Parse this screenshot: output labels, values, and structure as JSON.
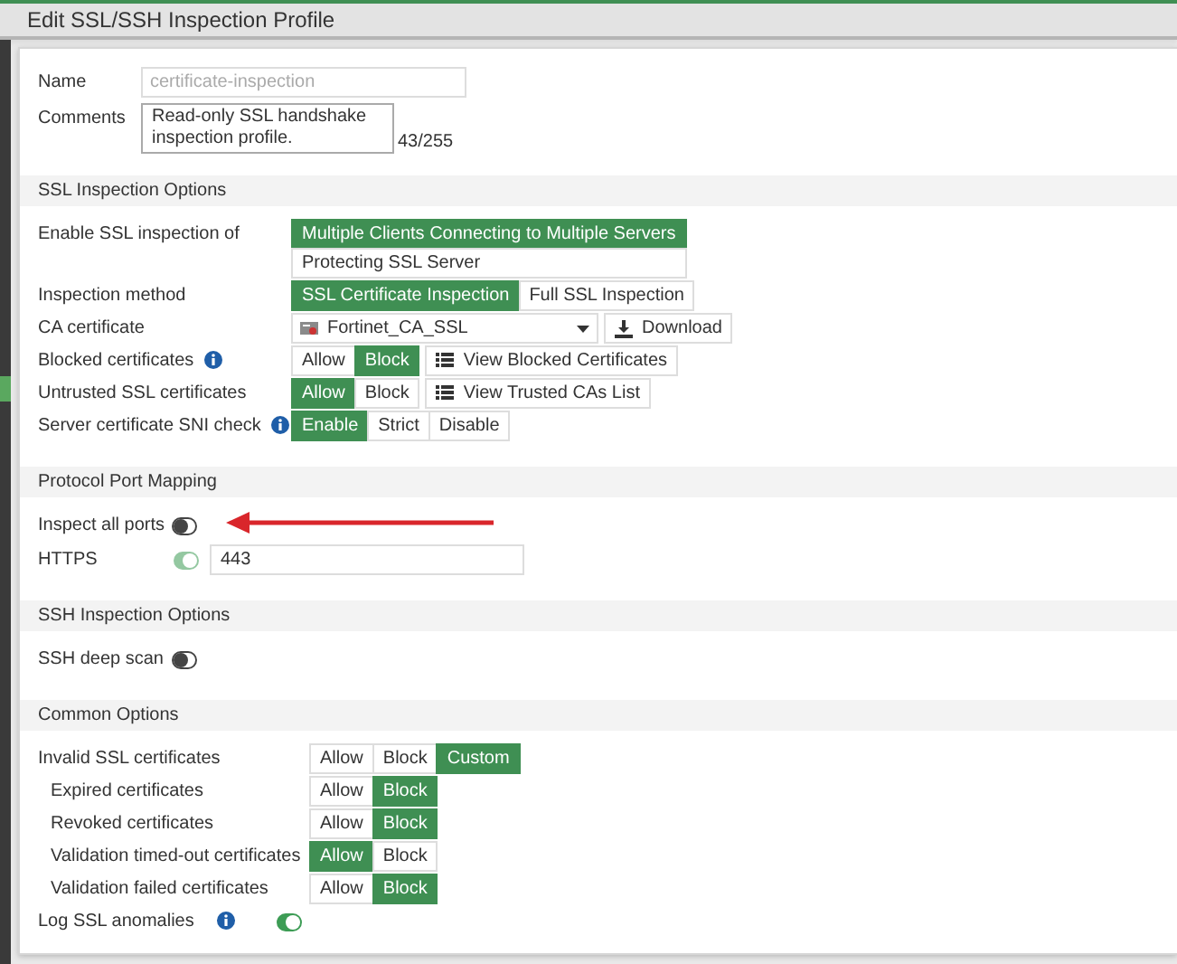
{
  "title": "Edit SSL/SSH Inspection Profile",
  "name_field": {
    "label": "Name",
    "value": "certificate-inspection",
    "disabled": true
  },
  "comments_field": {
    "label": "Comments",
    "value": "Read-only SSL handshake inspection profile.",
    "counter": "43/255"
  },
  "sections": [
    {
      "title": "SSL Inspection Options",
      "rows": [
        {
          "kind": "stacked",
          "label": "Enable SSL inspection of",
          "options": [
            {
              "label": "Multiple Clients Connecting to Multiple Servers",
              "selected": true
            },
            {
              "label": "Protecting SSL Server",
              "selected": false
            }
          ]
        },
        {
          "kind": "segmented",
          "label": "Inspection method",
          "options": [
            {
              "label": "SSL Certificate Inspection",
              "selected": true
            },
            {
              "label": "Full SSL Inspection",
              "selected": false
            }
          ]
        },
        {
          "kind": "select",
          "label": "CA certificate",
          "value": "Fortinet_CA_SSL",
          "button": "Download"
        },
        {
          "kind": "segmented",
          "label": "Blocked certificates",
          "info": true,
          "options": [
            {
              "label": "Allow",
              "selected": false
            },
            {
              "label": "Block",
              "selected": true
            }
          ],
          "button": "View Blocked Certificates"
        },
        {
          "kind": "segmented",
          "label": "Untrusted SSL certificates",
          "options": [
            {
              "label": "Allow",
              "selected": true
            },
            {
              "label": "Block",
              "selected": false
            }
          ],
          "button": "View Trusted CAs List"
        },
        {
          "kind": "segmented",
          "label": "Server certificate SNI check",
          "info": true,
          "options": [
            {
              "label": "Enable",
              "selected": true
            },
            {
              "label": "Strict",
              "selected": false
            },
            {
              "label": "Disable",
              "selected": false
            }
          ]
        }
      ]
    },
    {
      "title": "Protocol Port Mapping",
      "rows": [
        {
          "kind": "toggle",
          "label": "Inspect all ports",
          "on": false
        },
        {
          "kind": "port",
          "label": "HTTPS",
          "on": true,
          "disabled": true,
          "value": "443"
        }
      ]
    },
    {
      "title": "SSH Inspection Options",
      "rows": [
        {
          "kind": "toggle",
          "label": "SSH deep scan",
          "on": false
        }
      ]
    },
    {
      "title": "Common Options",
      "rows": [
        {
          "kind": "segmented",
          "label": "Invalid SSL certificates",
          "options": [
            {
              "label": "Allow",
              "selected": false
            },
            {
              "label": "Block",
              "selected": false
            },
            {
              "label": "Custom",
              "selected": true
            }
          ],
          "children": [
            {
              "kind": "segmented",
              "label": "Expired certificates",
              "options": [
                {
                  "label": "Allow",
                  "selected": false
                },
                {
                  "label": "Block",
                  "selected": true
                }
              ]
            },
            {
              "kind": "segmented",
              "label": "Revoked certificates",
              "options": [
                {
                  "label": "Allow",
                  "selected": false
                },
                {
                  "label": "Block",
                  "selected": true
                }
              ]
            },
            {
              "kind": "segmented",
              "label": "Validation timed-out certificates",
              "options": [
                {
                  "label": "Allow",
                  "selected": true
                },
                {
                  "label": "Block",
                  "selected": false
                }
              ]
            },
            {
              "kind": "segmented",
              "label": "Validation failed certificates",
              "options": [
                {
                  "label": "Allow",
                  "selected": false
                },
                {
                  "label": "Block",
                  "selected": true
                }
              ]
            }
          ]
        },
        {
          "kind": "toggle",
          "label": "Log SSL anomalies",
          "info": true,
          "on": true
        }
      ]
    }
  ]
}
